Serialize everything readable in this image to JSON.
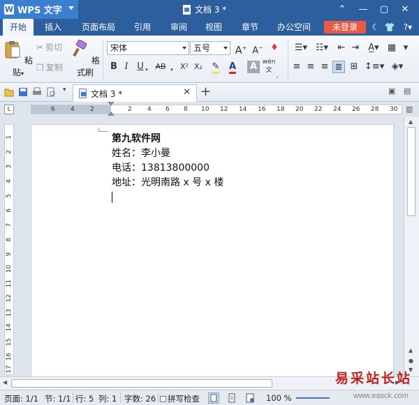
{
  "app": {
    "name": "WPS 文字",
    "logo": "W"
  },
  "window": {
    "doc_title": "文档 3 *"
  },
  "menu": {
    "items": [
      "开始",
      "插入",
      "页面布局",
      "引用",
      "审阅",
      "视图",
      "章节",
      "办公空间"
    ],
    "login": "未登录"
  },
  "ribbon": {
    "paste": "粘贴",
    "cut": "剪切",
    "copy": "复制",
    "format_painter": "格式刷",
    "font_name": "宋体",
    "font_size": "五号",
    "bold": "B",
    "italic": "I",
    "underline": "U",
    "strike": "AB",
    "superscript": "X²",
    "subscript": "X₂",
    "font_color": "A",
    "pinyin": "wén"
  },
  "tabs": {
    "doc": "文档 3 *"
  },
  "ruler": {
    "h_left": [
      "6",
      "4",
      "2"
    ],
    "h_right": [
      "2",
      "4",
      "6",
      "8",
      "10",
      "12",
      "14",
      "16",
      "18",
      "20",
      "22",
      "24",
      "26",
      "28",
      "30"
    ],
    "v": [
      "1",
      "2",
      "3",
      "4",
      "5",
      "6",
      "7",
      "8",
      "9",
      "10",
      "11",
      "12",
      "13",
      "14",
      "15",
      "16",
      "17"
    ]
  },
  "document": {
    "lines": [
      "第九软件网",
      "姓名：李小曼",
      "电话：13813800000",
      "地址：光明南路 x 号 x 楼"
    ]
  },
  "status": {
    "page": "页面: 1/1",
    "section": "节: 1/1",
    "row": "行: 5",
    "col": "列: 1",
    "words": "字数: 26",
    "spell": "拼写检查",
    "zoom": "100 %"
  },
  "watermark": {
    "main": "易采站长站",
    "sub": "www.easck.com"
  },
  "colors": {
    "titlebar": "#2d5f9e",
    "accent": "#3b7fd1",
    "login": "#e95a45",
    "watermark": "#c0201c"
  }
}
